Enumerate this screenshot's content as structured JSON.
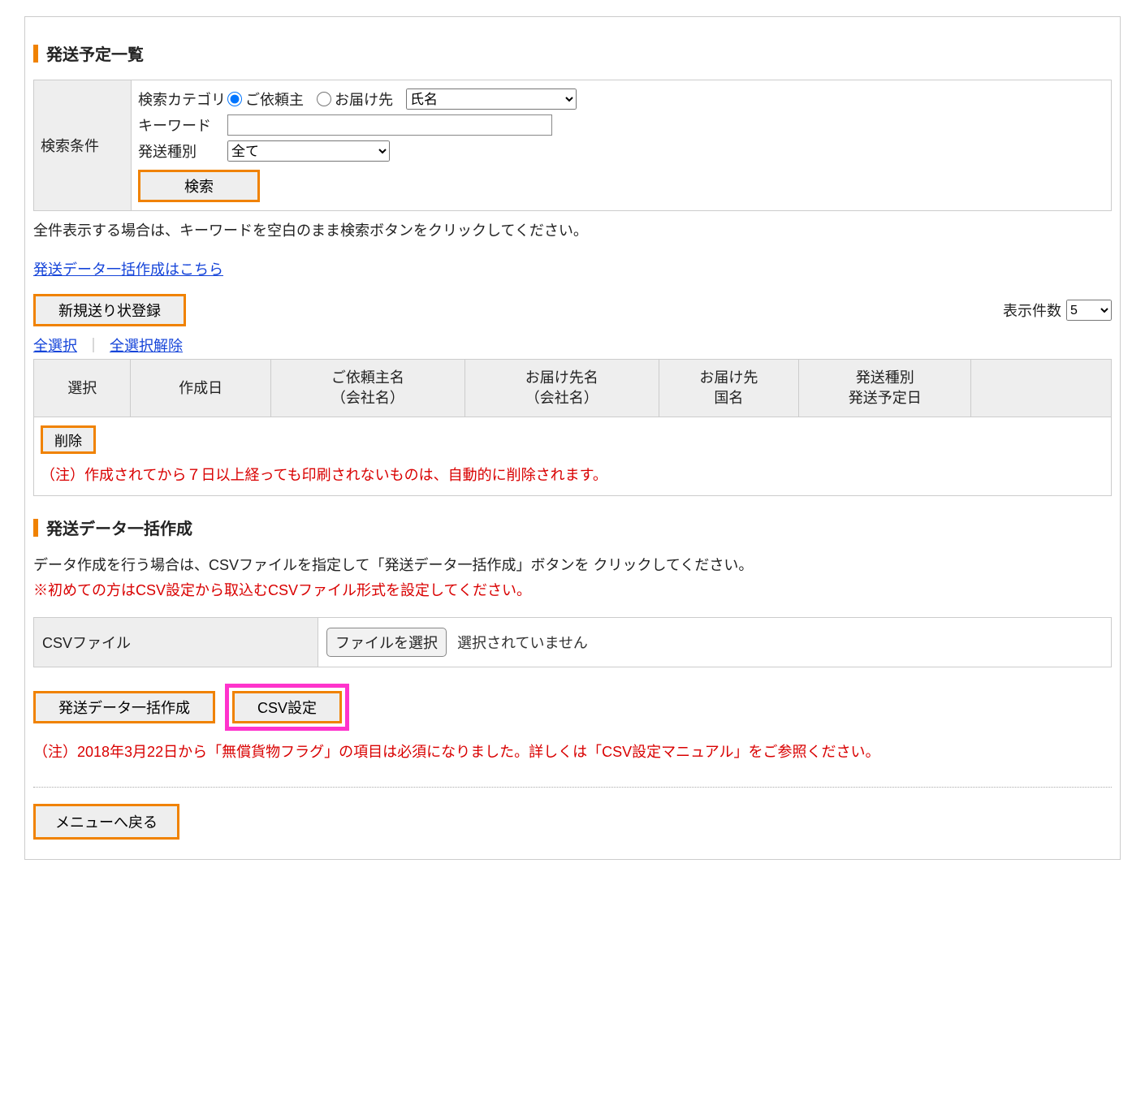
{
  "section1": {
    "title": "発送予定一覧",
    "search_cond_label": "検索条件",
    "category_label": "検索カテゴリ",
    "radio_requester": "ご依頼主",
    "radio_destination": "お届け先",
    "select_field_value": "氏名",
    "keyword_label": "キーワード",
    "keyword_value": "",
    "ship_type_label": "発送種別",
    "ship_type_value": "全て",
    "search_btn": "検索",
    "helper_text": "全件表示する場合は、キーワードを空白のまま検索ボタンをクリックしてください。"
  },
  "bulk_link": "発送データ一括作成はこちら",
  "top_buttons": {
    "new_slip": "新規送り状登録",
    "display_count_label": "表示件数",
    "display_count_value": "5"
  },
  "select_links": {
    "select_all": "全選択",
    "deselect_all": "全選択解除"
  },
  "table": {
    "headers": {
      "select": "選択",
      "created": "作成日",
      "requester_line1": "ご依頼主名",
      "requester_line2": "（会社名）",
      "dest_line1": "お届け先名",
      "dest_line2": "（会社名）",
      "country_line1": "お届け先",
      "country_line2": "国名",
      "type_line1": "発送種別",
      "type_line2": "発送予定日"
    },
    "delete_btn": "削除",
    "note": "（注）作成されてから７日以上経っても印刷されないものは、自動的に削除されます。"
  },
  "section2": {
    "title": "発送データ一括作成",
    "desc": "データ作成を行う場合は、CSVファイルを指定して「発送データ一括作成」ボタンを クリックしてください。",
    "first_time_note": "※初めての方はCSV設定から取込むCSVファイル形式を設定してください。",
    "csv_file_label": "CSVファイル",
    "file_select_btn": "ファイルを選択",
    "file_state": "選択されていません",
    "bulk_create_btn": "発送データ一括作成",
    "csv_settings_btn": "CSV設定",
    "note2": "（注）2018年3月22日から「無償貨物フラグ」の項目は必須になりました。詳しくは「CSV設定マニュアル」をご参照ください。"
  },
  "menu_back": "メニューへ戻る"
}
